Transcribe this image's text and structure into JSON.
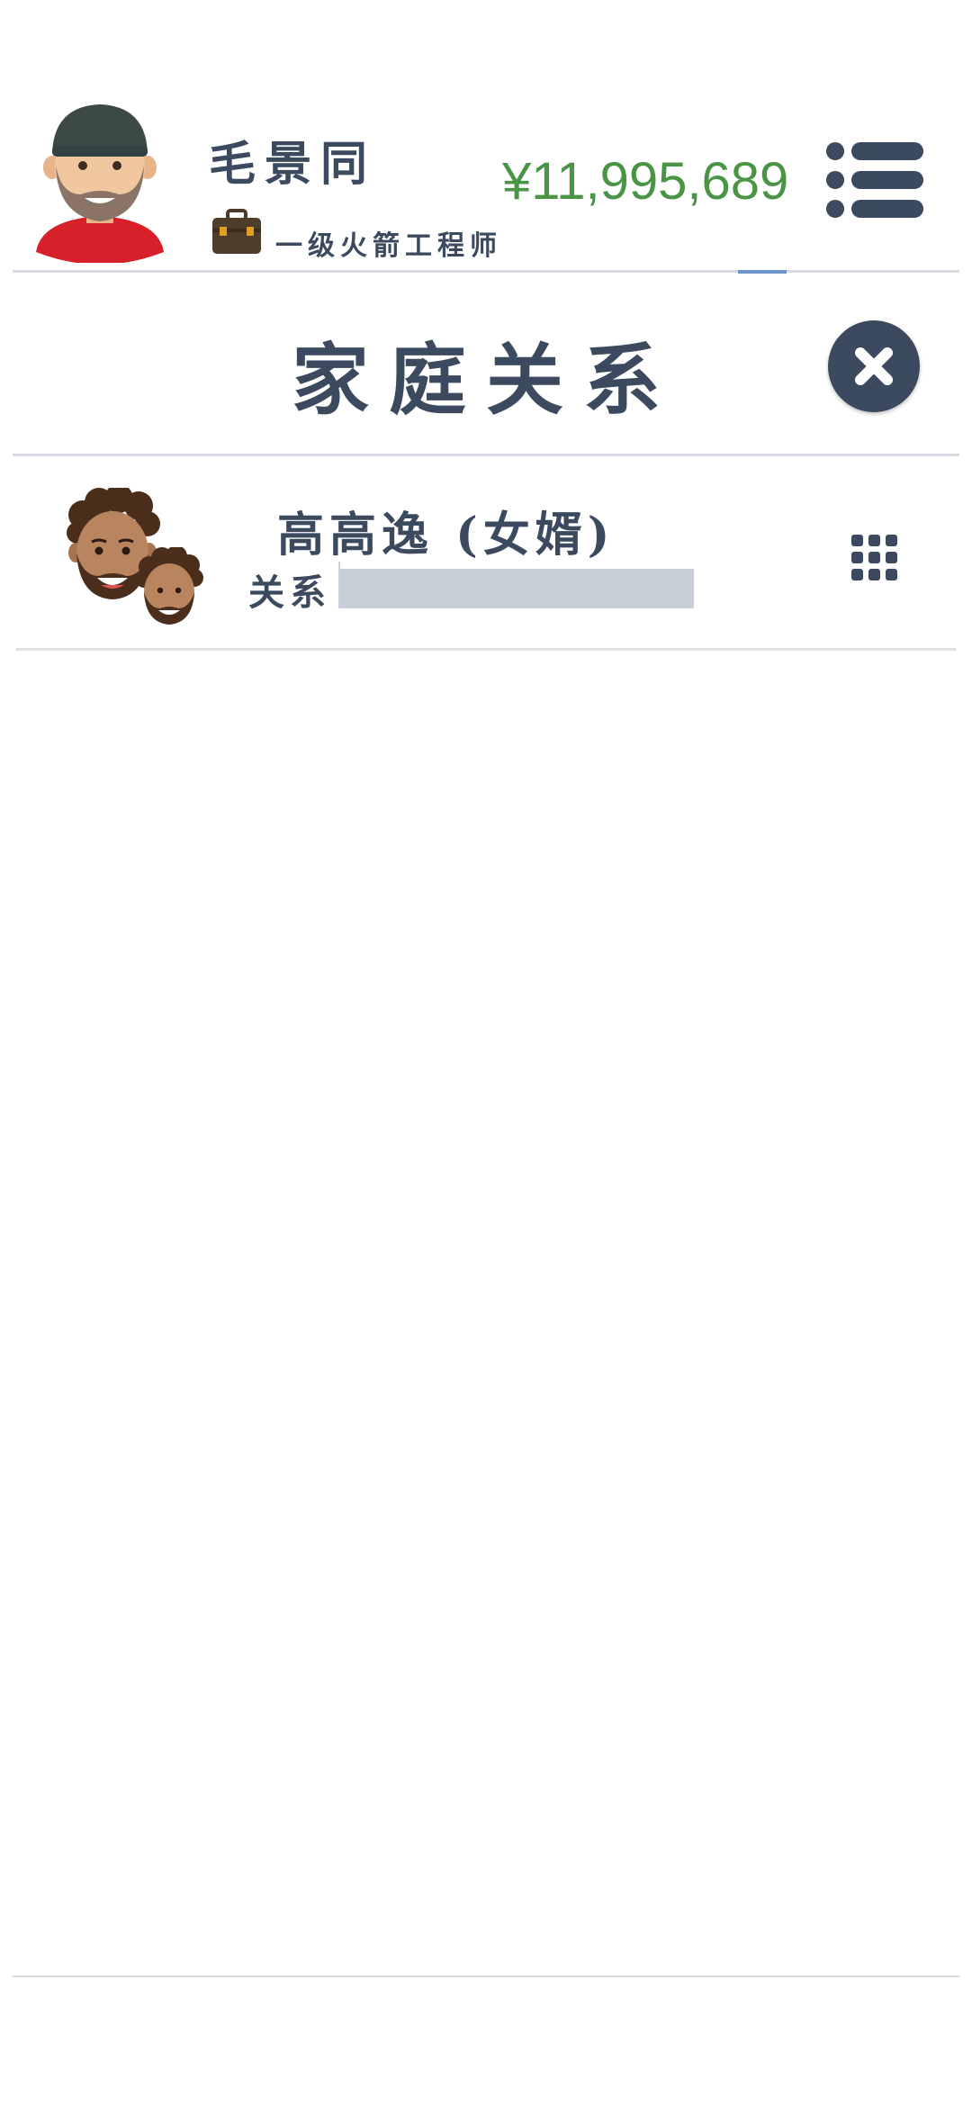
{
  "header": {
    "player_name": "毛景同",
    "job_title": "一级火箭工程师",
    "money": "¥11,995,689",
    "icons": {
      "avatar": "bearded-man-avatar-icon",
      "job": "briefcase-icon",
      "menu": "menu-list-icon"
    }
  },
  "panel": {
    "title": "家庭关系",
    "close_icon": "close-x-icon"
  },
  "relations": [
    {
      "name": "高高逸 (女婿)",
      "relation_label": "关系",
      "relation_level": 0.91,
      "avatar_icon": "curly-haired-man-avatar-icon",
      "child_avatar_icon": "curly-haired-child-avatar-icon",
      "action_icon": "grid-dots-icon"
    }
  ],
  "colors": {
    "primary_text": "#3b4a5e",
    "money": "#4a9545",
    "relation_bar": "#c8cfd8",
    "divider": "#d6dbe2",
    "accent": "#6b94c9"
  }
}
